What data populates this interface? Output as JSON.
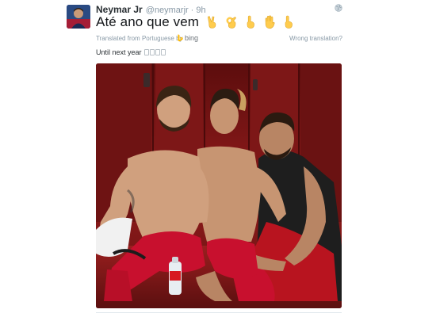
{
  "tweet": {
    "author_name": "Neymar Jr",
    "handle": "@neymarjr",
    "separator": "·",
    "time": "9h",
    "text": "Até ano que vem",
    "emoji_icons": [
      "victory-hand",
      "ok-hand",
      "pointing-up",
      "raised-hand",
      "pointing-up"
    ],
    "translation_label": "Translated from Portuguese by",
    "translation_provider": "bing",
    "wrong_translation": "Wrong translation?",
    "translated_text": "Until next year",
    "photo_alt": "Photo of three football players in a locker room"
  },
  "colors": {
    "text_primary": "#14171a",
    "text_secondary": "#8899a6",
    "bing_yellow": "#ffb900",
    "locker_red": "#8f1b1b",
    "jersey_red": "#c8102e"
  }
}
